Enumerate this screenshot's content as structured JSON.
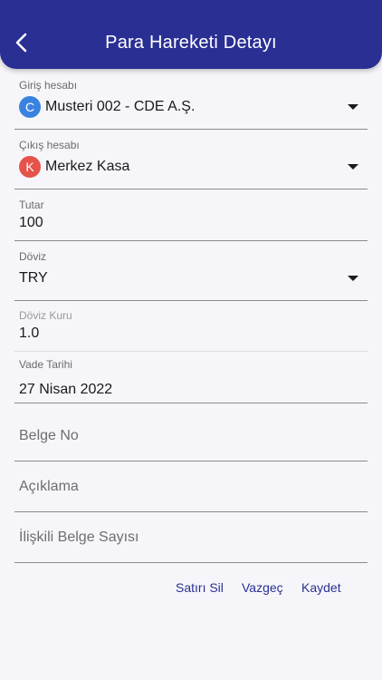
{
  "header": {
    "title": "Para Hareketi Detayı",
    "back_icon": "chevron-left-icon",
    "background": "#2a2f94"
  },
  "form": {
    "giris": {
      "label": "Giriş hesabı",
      "avatar_letter": "C",
      "avatar_color": "#3a82e0",
      "value": "Musteri 002 - CDE A.Ş."
    },
    "cikis": {
      "label": "Çıkış hesabı",
      "avatar_letter": "K",
      "avatar_color": "#e5534b",
      "value": "Merkez Kasa"
    },
    "tutar": {
      "label": "Tutar",
      "value": "100"
    },
    "doviz": {
      "label": "Döviz",
      "value": "TRY"
    },
    "doviz_kuru": {
      "label": "Döviz Kuru",
      "value": "1.0"
    },
    "vade_tarihi": {
      "label": "Vade Tarihi",
      "value": "27 Nisan 2022"
    },
    "belge_no": {
      "placeholder": "Belge No"
    },
    "aciklama": {
      "placeholder": "Açıklama"
    },
    "iliskili": {
      "placeholder": "İlişkili Belge Sayısı"
    }
  },
  "actions": {
    "delete_label": "Satırı Sil",
    "cancel_label": "Vazgeç",
    "save_label": "Kaydet"
  }
}
